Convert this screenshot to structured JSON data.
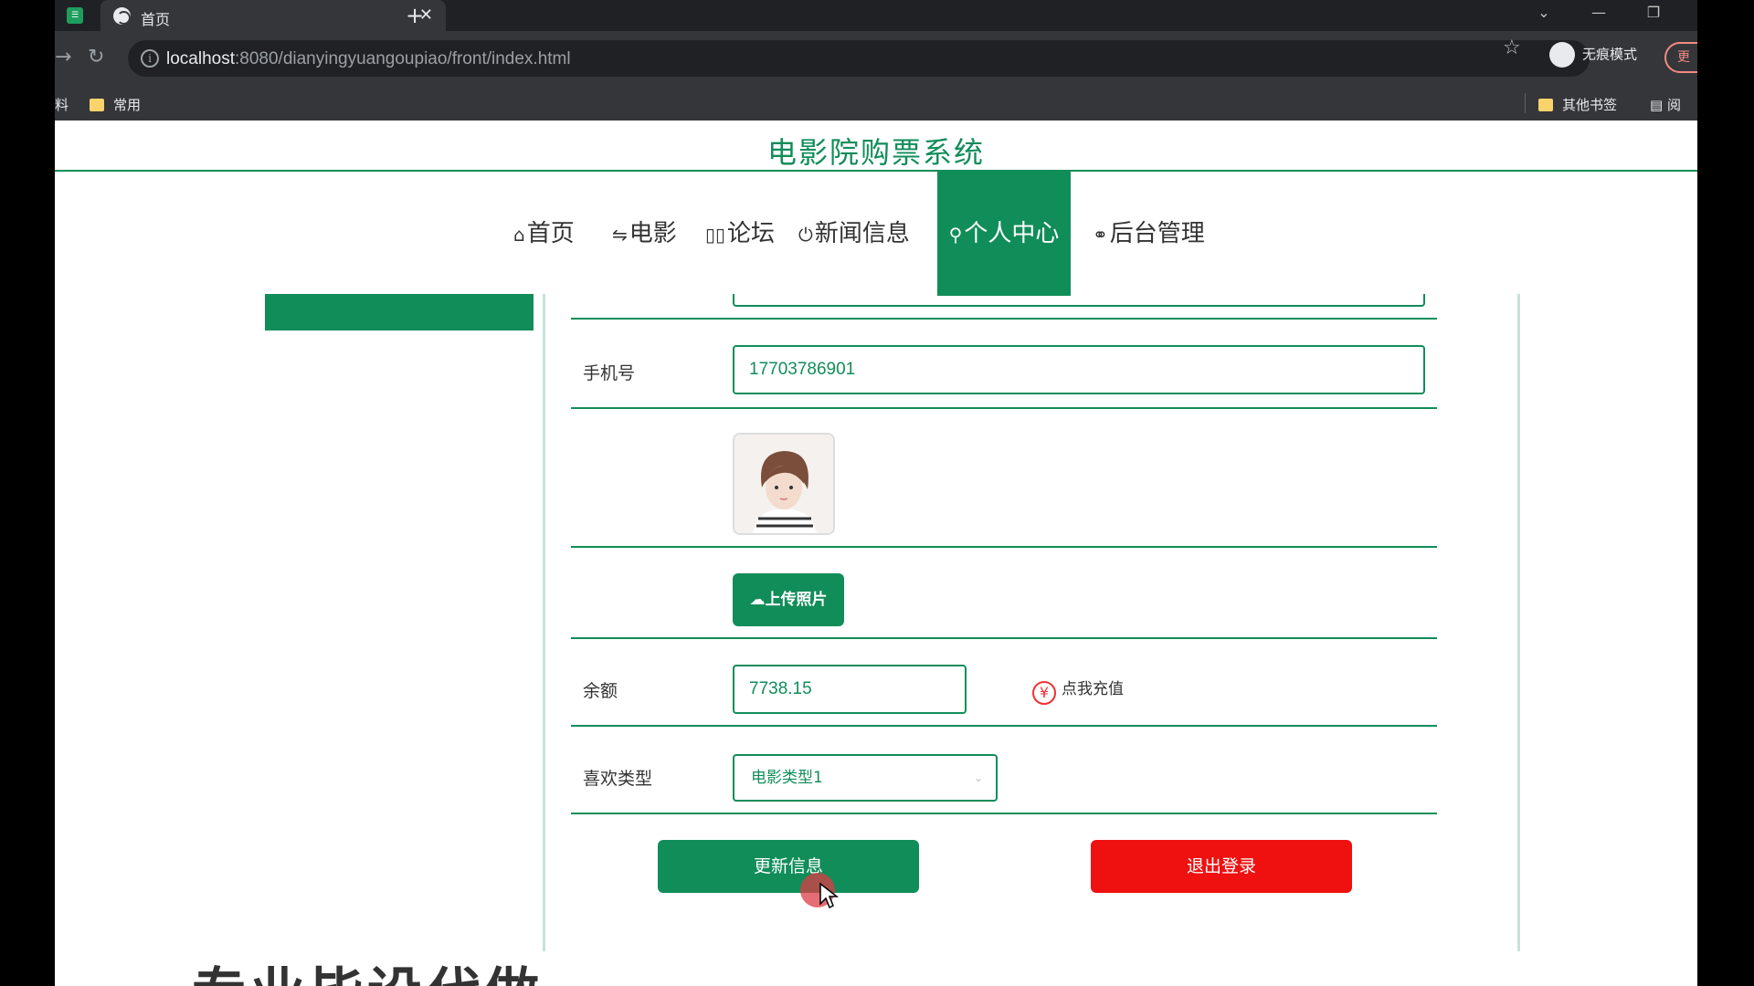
{
  "browser": {
    "tab_title": "首页",
    "tab_close": "✕",
    "new_tab": "+",
    "url_host": "localhost",
    "url_rest": ":8080/dianyingyuangoupiao/front/index.html",
    "profile_label": "无痕模式",
    "update_label": "更",
    "bookmarks": {
      "left_partial": "料",
      "folder_common": "常用",
      "other_bookmarks": "其他书签",
      "reading_partial": "阅"
    }
  },
  "site": {
    "title": "电影院购票系统",
    "nav": [
      {
        "icon": "⌂",
        "label": "首页"
      },
      {
        "icon": "⇋",
        "label": "电影"
      },
      {
        "icon": "▯▯",
        "label": "论坛"
      },
      {
        "icon": "⏻",
        "label": "新闻信息"
      },
      {
        "icon": "⚲",
        "label": "个人中心",
        "active": true
      },
      {
        "icon": "⚭",
        "label": "后台管理"
      }
    ]
  },
  "profile_form": {
    "phone_label": "手机号",
    "phone_value": "17703786901",
    "upload_button": "上传照片",
    "balance_label": "余额",
    "balance_value": "7738.15",
    "recharge_text": "点我充值",
    "fav_type_label": "喜欢类型",
    "fav_type_value": "电影类型1",
    "update_button": "更新信息",
    "logout_button": "退出登录"
  },
  "overlay_text": "专业毕设代做",
  "colors": {
    "accent": "#118d5a",
    "danger": "#ef1010"
  }
}
